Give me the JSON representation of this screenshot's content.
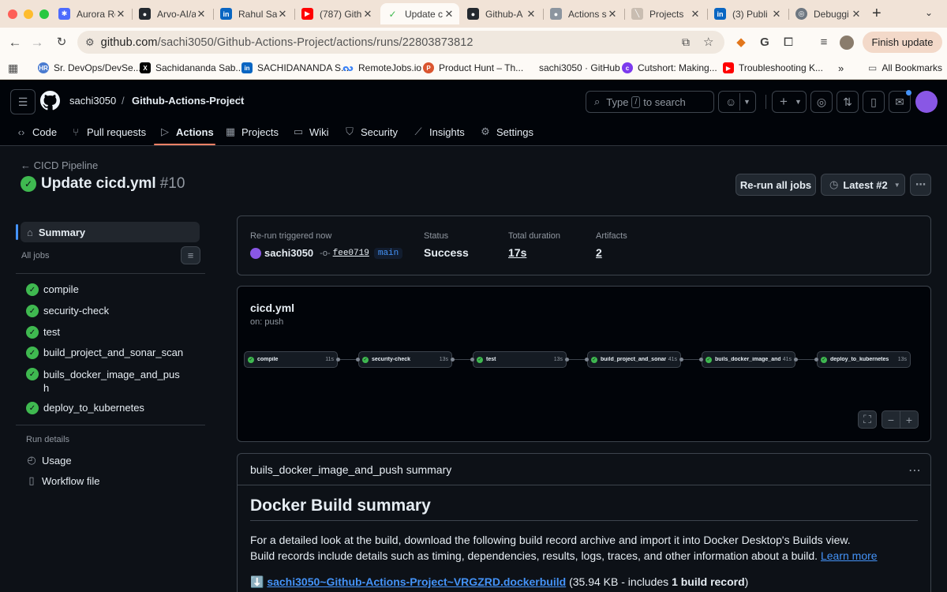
{
  "browser": {
    "tabs": [
      {
        "title": "Aurora Ro",
        "favicon_color": "#4d6bfe",
        "active": false
      },
      {
        "title": "Arvo-AI/a",
        "favicon_color": "#24292f",
        "active": false
      },
      {
        "title": "Rahul Sas",
        "favicon_color": "#0a66c2",
        "active": false
      },
      {
        "title": "(787) Gith",
        "favicon_color": "#ff0000",
        "active": false
      },
      {
        "title": "Update c",
        "favicon_color": "#3fb950",
        "active": true
      },
      {
        "title": "Github-A",
        "favicon_color": "#24292f",
        "active": false
      },
      {
        "title": "Actions s",
        "favicon_color": "#8c959f",
        "active": false
      },
      {
        "title": "Projects",
        "favicon_color": "#c9bdb1",
        "active": false
      },
      {
        "title": "(3) Publi",
        "favicon_color": "#0a66c2",
        "active": false
      },
      {
        "title": "Debuggi",
        "favicon_color": "#6e7781",
        "active": false
      }
    ],
    "url_host": "github.com",
    "url_path": "/sachi3050/Github-Actions-Project/actions/runs/22803873812",
    "finish_update_label": "Finish update",
    "bookmarks": [
      {
        "label": "Sr. DevOps/DevSe...",
        "favicon_color": "#4a7bd0"
      },
      {
        "label": "Sachidananda Sab...",
        "favicon_color": "#000000"
      },
      {
        "label": "SACHIDANANDA S...",
        "favicon_color": "#0a66c2"
      },
      {
        "label": "RemoteJobs.io",
        "favicon_color": "#3b82f6"
      },
      {
        "label": "Product Hunt – Th...",
        "favicon_color": "#da552f"
      },
      {
        "label": "sachi3050 · GitHub",
        "favicon_color": ""
      },
      {
        "label": "Cutshort: Making...",
        "favicon_color": "#7c3aed"
      },
      {
        "label": "Troubleshooting K...",
        "favicon_color": "#ff0000"
      }
    ],
    "all_bookmarks_label": "All Bookmarks"
  },
  "header": {
    "owner": "sachi3050",
    "separator": "/",
    "repo": "Github-Actions-Project",
    "search_prefix": "Type",
    "search_key": "/",
    "search_suffix": "to search"
  },
  "repo_nav": [
    {
      "label": "Code",
      "icon": "code-icon"
    },
    {
      "label": "Pull requests",
      "icon": "pull-request-icon"
    },
    {
      "label": "Actions",
      "icon": "play-icon"
    },
    {
      "label": "Projects",
      "icon": "table-icon"
    },
    {
      "label": "Wiki",
      "icon": "book-icon"
    },
    {
      "label": "Security",
      "icon": "shield-icon"
    },
    {
      "label": "Insights",
      "icon": "graph-icon"
    },
    {
      "label": "Settings",
      "icon": "gear-icon"
    }
  ],
  "run": {
    "back_label": "CICD Pipeline",
    "title": "Update cicd.yml",
    "number": "#10",
    "rerun_label": "Re-run all jobs",
    "attempt_label": "Latest #2"
  },
  "sidebar": {
    "summary_label": "Summary",
    "all_jobs_label": "All jobs",
    "jobs": [
      "compile",
      "security-check",
      "test",
      "build_project_and_sonar_scan",
      "buils_docker_image_and_pus",
      "deploy_to_kubernetes"
    ],
    "job_wrap": "h",
    "run_details_label": "Run details",
    "run_details": [
      {
        "label": "Usage",
        "icon": "stopwatch-icon"
      },
      {
        "label": "Workflow file",
        "icon": "file-icon"
      }
    ]
  },
  "summary": {
    "trigger_label": "Re-run triggered now",
    "actor": "sachi3050",
    "commit": "fee0719",
    "branch": "main",
    "status_label": "Status",
    "status_value": "Success",
    "duration_label": "Total duration",
    "duration_value": "17s",
    "artifacts_label": "Artifacts",
    "artifacts_value": "2"
  },
  "workflow": {
    "file": "cicd.yml",
    "trigger": "on: push",
    "nodes": [
      {
        "name": "compile",
        "duration": "11s"
      },
      {
        "name": "security-check",
        "duration": "13s"
      },
      {
        "name": "test",
        "duration": "13s"
      },
      {
        "name": "build_project_and_sonar_...",
        "duration": "41s"
      },
      {
        "name": "buils_docker_image_and_...",
        "duration": "41s"
      },
      {
        "name": "deploy_to_kubernetes",
        "duration": "13s"
      }
    ]
  },
  "job_summary": {
    "title": "buils_docker_image_and_push summary",
    "heading": "Docker Build summary",
    "line1": "For a detailed look at the build, download the following build record archive and import it into Docker Desktop's Builds view.",
    "line2": "Build records include details such as timing, dependencies, results, logs, traces, and other information about a build.",
    "learn_more": "Learn more",
    "download_icon": "⬇️",
    "archive_name": "sachi3050~Github-Actions-Project~VRGZRD.dockerbuild",
    "archive_meta_prefix": "(35.94 KB - includes",
    "archive_meta_bold": "1 build record",
    "archive_meta_suffix": ")"
  },
  "colors": {
    "success": "#3fb950",
    "link": "#4493f8",
    "active_tab_underline": "#f78166"
  }
}
